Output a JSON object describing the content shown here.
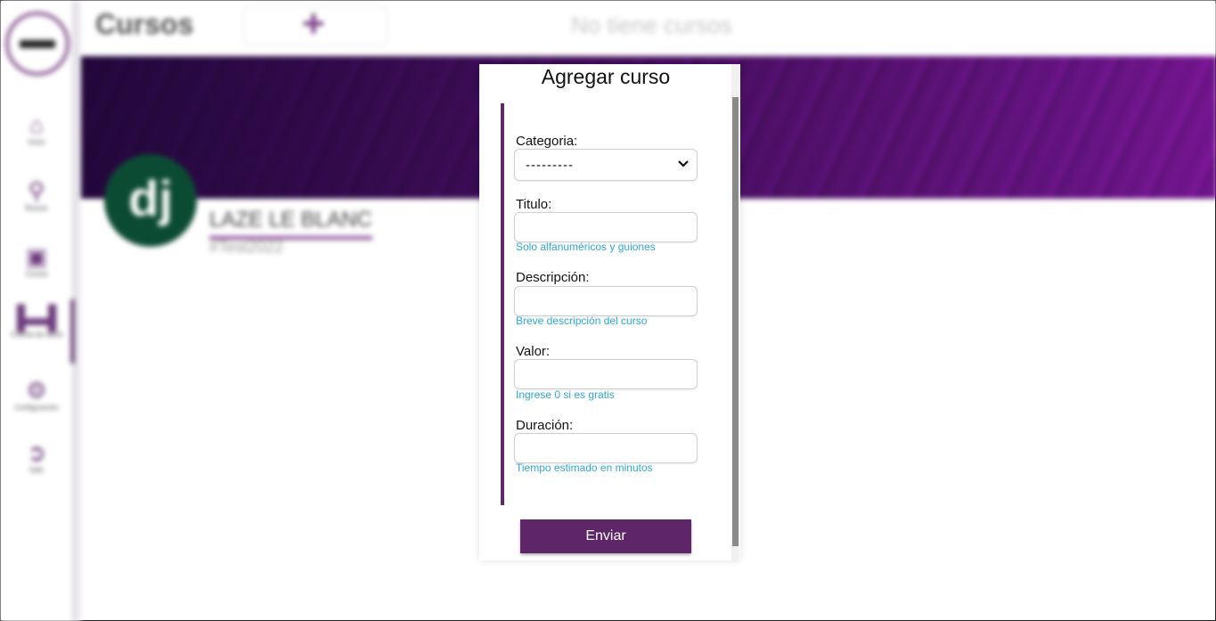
{
  "header": {
    "title": "Cursos",
    "empty_message": "No tiene cursos"
  },
  "sidebar": {
    "items": [
      {
        "label": "Inicio",
        "icon": "home-icon"
      },
      {
        "label": "Buscar",
        "icon": "search-icon"
      },
      {
        "label": "Cursos",
        "icon": "briefcase-icon"
      },
      {
        "label": "Cuenta de salud",
        "icon": "dumbbell-icon"
      },
      {
        "label": "Configuración",
        "icon": "gears-icon"
      },
      {
        "label": "Salir",
        "icon": "logout-icon"
      }
    ]
  },
  "profile": {
    "avatar_text": "dj",
    "name": "LAZE LE BLANC",
    "handle": "#Test2022"
  },
  "modal": {
    "title": "Agregar curso",
    "fields": {
      "categoria": {
        "label": "Categoria:",
        "value": "---------"
      },
      "titulo": {
        "label": "Titulo:",
        "value": "",
        "help": "Solo alfanuméricos y guiones"
      },
      "descripcion": {
        "label": "Descripción:",
        "value": "",
        "help": "Breve descripción del curso"
      },
      "valor": {
        "label": "Valor:",
        "value": "",
        "help": "Ingrese 0 si es gratis"
      },
      "duracion": {
        "label": "Duración:",
        "value": "",
        "help": "Tiempo estimado en minutos"
      }
    },
    "submit_label": "Enviar"
  },
  "colors": {
    "accent": "#5e2568",
    "help_text": "#2ea7d9",
    "banner_dark": "#2b0f45",
    "banner_light": "#8a2a95"
  }
}
